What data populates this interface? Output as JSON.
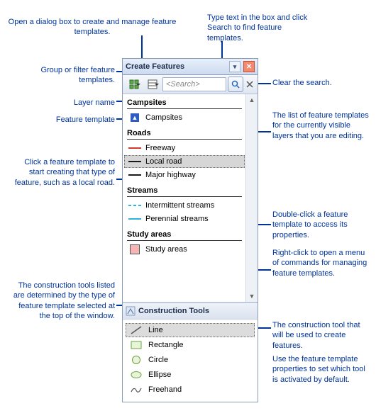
{
  "panel": {
    "title": "Create Features",
    "search_placeholder": "<Search>",
    "groups": [
      {
        "header": "Campsites",
        "items": [
          {
            "label": "Campsites",
            "sym": "tent",
            "color": "#2f5cc0",
            "selected": false
          }
        ]
      },
      {
        "header": "Roads",
        "items": [
          {
            "label": "Freeway",
            "sym": "line",
            "color": "#d23a2e",
            "selected": false
          },
          {
            "label": "Local road",
            "sym": "line",
            "color": "#1a1a1a",
            "selected": true
          },
          {
            "label": "Major highway",
            "sym": "line",
            "color": "#1a1a1a",
            "selected": false
          }
        ]
      },
      {
        "header": "Streams",
        "items": [
          {
            "label": "Intermittent streams",
            "sym": "dash",
            "color": "#2fb3d6",
            "selected": false
          },
          {
            "label": "Perennial streams",
            "sym": "line",
            "color": "#2fb3d6",
            "selected": false
          }
        ]
      },
      {
        "header": "Study areas",
        "items": [
          {
            "label": "Study areas",
            "sym": "box",
            "color": "#f6b6b6",
            "selected": false
          }
        ]
      }
    ],
    "construction_title": "Construction Tools",
    "tools": [
      {
        "label": "Line",
        "sym": "line-tool",
        "selected": true
      },
      {
        "label": "Rectangle",
        "sym": "rect-tool",
        "selected": false
      },
      {
        "label": "Circle",
        "sym": "circle-tool",
        "selected": false
      },
      {
        "label": "Ellipse",
        "sym": "ellipse-tool",
        "selected": false
      },
      {
        "label": "Freehand",
        "sym": "free-tool",
        "selected": false
      }
    ]
  },
  "annotations": {
    "a1": "Open a dialog box to create and manage feature templates.",
    "a2": "Type text in the box and click Search to find feature templates.",
    "a3": "Group or filter feature templates.",
    "a4": "Layer name",
    "a5": "Feature template",
    "a6": "Click a feature template to start creating that type of feature, such as a local road.",
    "a7": "The construction tools listed are determined by the type of feature template selected at the top of the window.",
    "a8": "Clear the search.",
    "a9": "The list of feature templates for the currently visible layers that you are editing.",
    "a10": "Double-click a feature template to access its properties.",
    "a11": "Right-click to open a menu of commands for managing feature templates.",
    "a12": "The construction tool that will be used to create features.",
    "a13": "Use the feature template properties to set which tool is activated by default."
  }
}
